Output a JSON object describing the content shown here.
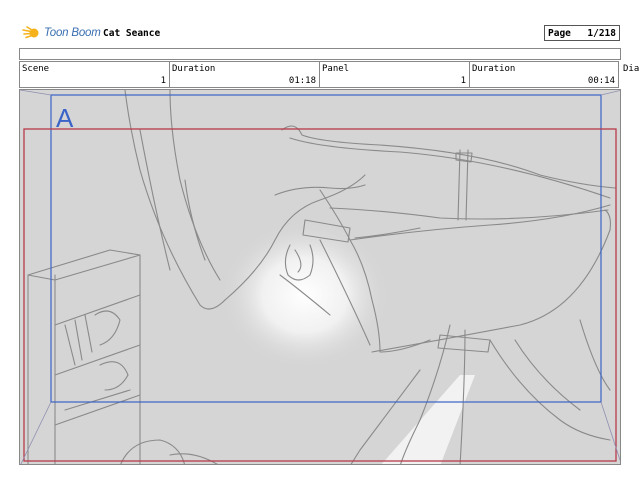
{
  "header": {
    "logo_text": "Toon Boom",
    "project_title": "Cat Seance",
    "page_label": "Page",
    "page_value": "1/218"
  },
  "info": {
    "scene_label": "Scene",
    "scene_value": "1",
    "duration1_label": "Duration",
    "duration1_value": "01:18",
    "panel_label": "Panel",
    "panel_value": "1",
    "duration2_label": "Duration",
    "duration2_value": "00:14",
    "dialog_label": "Dia"
  },
  "panel": {
    "camera_label": "A",
    "camera_color": "#3a64c8",
    "safe_frame_color": "#b83a48"
  }
}
